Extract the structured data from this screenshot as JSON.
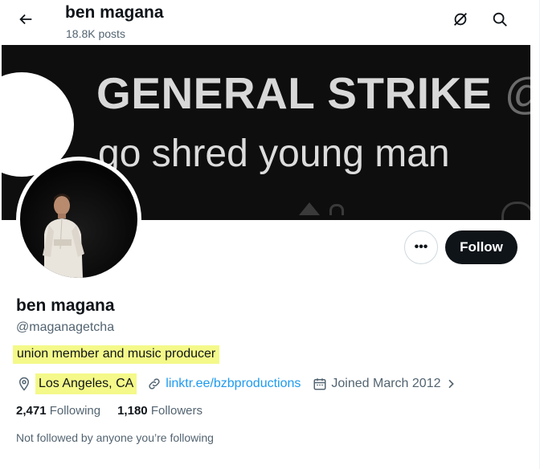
{
  "header": {
    "name": "ben magana",
    "posts": "18.8K posts"
  },
  "banner": {
    "line1": "GENERAL STRIKE",
    "line1_handle": "@f",
    "line2": "go shred young man"
  },
  "profile": {
    "name": "ben magana",
    "handle": "@maganagetcha",
    "bio": "union member and music producer",
    "location": "Los Angeles, CA",
    "link": "linktr.ee/bzbproductions",
    "joined": "Joined March 2012",
    "following_count": "2,471",
    "following_label": "Following",
    "followers_count": "1,180",
    "followers_label": "Followers",
    "not_followed": "Not followed by anyone you’re following"
  },
  "actions": {
    "more_label": "•••",
    "follow_label": "Follow"
  },
  "icons": {
    "back": "arrow-left-icon",
    "grok": "grok-icon",
    "search": "search-icon",
    "location": "location-pin-icon",
    "link": "link-icon",
    "calendar": "calendar-icon",
    "chevron": "chevron-right-icon"
  },
  "colors": {
    "highlight": "#f4f989",
    "link": "#1d9bf0",
    "secondary_text": "#536471",
    "follow_bg": "#0f1419"
  }
}
